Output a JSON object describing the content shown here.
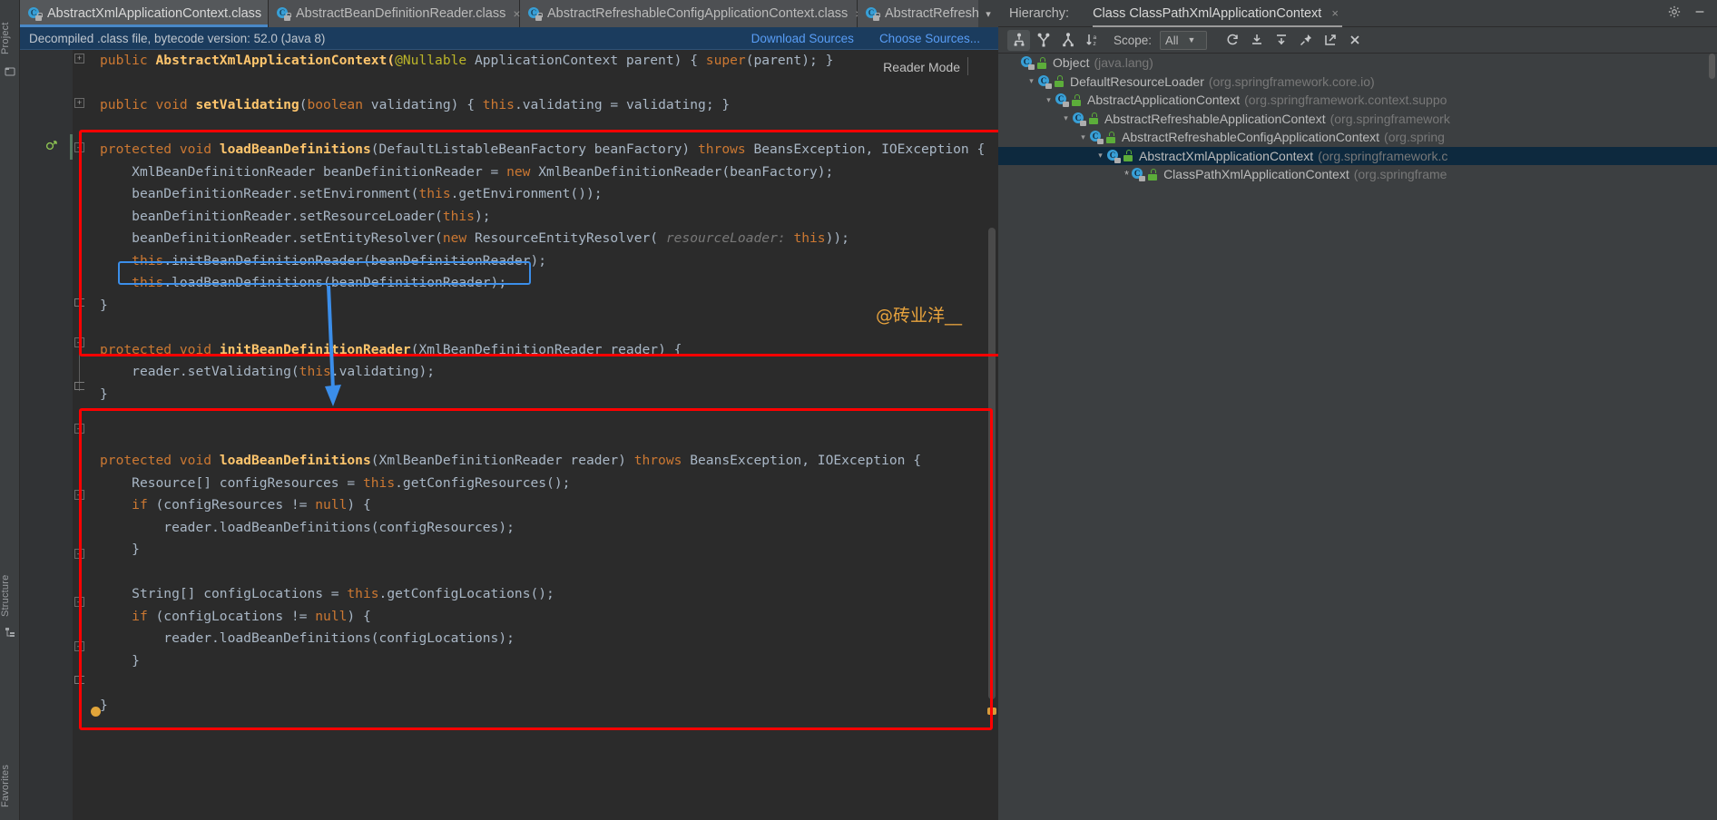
{
  "left_strip": {
    "project_label": "Project",
    "structure_label": "Structure",
    "favorites_label": "Favorites"
  },
  "tabs": [
    {
      "label": "AbstractXmlApplicationContext.class",
      "icon": "java-class-icon",
      "active": true,
      "close": "×"
    },
    {
      "label": "AbstractBeanDefinitionReader.class",
      "icon": "java-class-icon",
      "active": false,
      "close": "×"
    },
    {
      "label": "AbstractRefreshableConfigApplicationContext.class",
      "icon": "java-class-icon",
      "active": false,
      "close": "×"
    },
    {
      "label": "AbstractRefreshab",
      "icon": "java-class-icon",
      "active": false,
      "close": ""
    }
  ],
  "tab_overflow_icon": "chevron-down-icon",
  "notification": {
    "text": "Decompiled .class file, bytecode version: 52.0 (Java 8)",
    "download_sources": "Download Sources",
    "choose_sources": "Choose Sources..."
  },
  "editor": {
    "reader_mode": "Reader Mode",
    "watermark": "@砖业洋__",
    "lines": [
      {
        "indent": 0,
        "tokens": [
          {
            "t": "public ",
            "c": "kw"
          },
          {
            "t": "AbstractXmlApplicationContext(",
            "c": "mth"
          },
          {
            "t": "@Nullable",
            "c": "anno"
          },
          {
            "t": " ApplicationContext parent) { ",
            "c": "plain"
          },
          {
            "t": "super",
            "c": "kw"
          },
          {
            "t": "(parent); }",
            "c": "plain"
          }
        ]
      },
      {
        "indent": 0,
        "tokens": []
      },
      {
        "indent": 0,
        "tokens": [
          {
            "t": "public ",
            "c": "kw"
          },
          {
            "t": "void ",
            "c": "kw"
          },
          {
            "t": "setValidating",
            "c": "mth"
          },
          {
            "t": "(",
            "c": "plain"
          },
          {
            "t": "boolean",
            "c": "kw"
          },
          {
            "t": " validating) { ",
            "c": "plain"
          },
          {
            "t": "this",
            "c": "kw"
          },
          {
            "t": ".validating = validating; }",
            "c": "plain"
          }
        ]
      },
      {
        "indent": 0,
        "tokens": []
      },
      {
        "indent": 0,
        "tokens": [
          {
            "t": "protected ",
            "c": "kw"
          },
          {
            "t": "void ",
            "c": "kw"
          },
          {
            "t": "loadBeanDefinitions",
            "c": "mth"
          },
          {
            "t": "(DefaultListableBeanFactory beanFactory) ",
            "c": "plain"
          },
          {
            "t": "throws",
            "c": "kw"
          },
          {
            "t": " BeansException, IOException {",
            "c": "plain"
          }
        ]
      },
      {
        "indent": 1,
        "tokens": [
          {
            "t": "XmlBeanDefinitionReader beanDefinitionReader = ",
            "c": "plain"
          },
          {
            "t": "new",
            "c": "kw"
          },
          {
            "t": " XmlBeanDefinitionReader(beanFactory);",
            "c": "plain"
          }
        ]
      },
      {
        "indent": 1,
        "tokens": [
          {
            "t": "beanDefinitionReader.setEnvironment(",
            "c": "plain"
          },
          {
            "t": "this",
            "c": "kw"
          },
          {
            "t": ".getEnvironment());",
            "c": "plain"
          }
        ]
      },
      {
        "indent": 1,
        "tokens": [
          {
            "t": "beanDefinitionReader.setResourceLoader(",
            "c": "plain"
          },
          {
            "t": "this",
            "c": "kw"
          },
          {
            "t": ");",
            "c": "plain"
          }
        ]
      },
      {
        "indent": 1,
        "tokens": [
          {
            "t": "beanDefinitionReader.setEntityResolver(",
            "c": "plain"
          },
          {
            "t": "new",
            "c": "kw"
          },
          {
            "t": " ResourceEntityResolver( ",
            "c": "plain"
          },
          {
            "t": "resourceLoader:",
            "c": "hint"
          },
          {
            "t": " ",
            "c": "plain"
          },
          {
            "t": "this",
            "c": "kw"
          },
          {
            "t": "));",
            "c": "plain"
          }
        ]
      },
      {
        "indent": 1,
        "tokens": [
          {
            "t": "this",
            "c": "kw"
          },
          {
            "t": ".initBeanDefinitionReader(beanDefinitionReader);",
            "c": "plain"
          }
        ]
      },
      {
        "indent": 1,
        "tokens": [
          {
            "t": "this",
            "c": "kw"
          },
          {
            "t": ".loadBeanDefinitions(beanDefinitionReader);",
            "c": "plain"
          }
        ]
      },
      {
        "indent": 0,
        "tokens": [
          {
            "t": "}",
            "c": "plain"
          }
        ]
      },
      {
        "indent": 0,
        "tokens": []
      },
      {
        "indent": 0,
        "tokens": [
          {
            "t": "protected ",
            "c": "kw"
          },
          {
            "t": "void ",
            "c": "kw"
          },
          {
            "t": "initBeanDefinitionReader",
            "c": "mth"
          },
          {
            "t": "(XmlBeanDefinitionReader reader) {",
            "c": "plain"
          }
        ]
      },
      {
        "indent": 1,
        "tokens": [
          {
            "t": "reader.setValidating(",
            "c": "plain"
          },
          {
            "t": "this",
            "c": "kw"
          },
          {
            "t": ".validating);",
            "c": "plain"
          }
        ]
      },
      {
        "indent": 0,
        "tokens": [
          {
            "t": "}",
            "c": "plain"
          }
        ]
      },
      {
        "indent": 0,
        "tokens": []
      },
      {
        "indent": 0,
        "tokens": []
      },
      {
        "indent": 0,
        "tokens": [
          {
            "t": "protected ",
            "c": "kw"
          },
          {
            "t": "void ",
            "c": "kw"
          },
          {
            "t": "loadBeanDefinitions",
            "c": "mth"
          },
          {
            "t": "(XmlBeanDefinitionReader reader) ",
            "c": "plain"
          },
          {
            "t": "throws",
            "c": "kw"
          },
          {
            "t": " BeansException, IOException {",
            "c": "plain"
          }
        ]
      },
      {
        "indent": 1,
        "tokens": [
          {
            "t": "Resource[] configResources = ",
            "c": "plain"
          },
          {
            "t": "this",
            "c": "kw"
          },
          {
            "t": ".getConfigResources();",
            "c": "plain"
          }
        ]
      },
      {
        "indent": 1,
        "tokens": [
          {
            "t": "if",
            "c": "kw"
          },
          {
            "t": " (configResources != ",
            "c": "plain"
          },
          {
            "t": "null",
            "c": "kw"
          },
          {
            "t": ") {",
            "c": "plain"
          }
        ]
      },
      {
        "indent": 2,
        "tokens": [
          {
            "t": "reader.loadBeanDefinitions(configResources);",
            "c": "plain"
          }
        ]
      },
      {
        "indent": 1,
        "tokens": [
          {
            "t": "}",
            "c": "plain"
          }
        ]
      },
      {
        "indent": 0,
        "tokens": []
      },
      {
        "indent": 1,
        "tokens": [
          {
            "t": "String[] configLocations = ",
            "c": "plain"
          },
          {
            "t": "this",
            "c": "kw"
          },
          {
            "t": ".getConfigLocations();",
            "c": "plain"
          }
        ]
      },
      {
        "indent": 1,
        "tokens": [
          {
            "t": "if",
            "c": "kw"
          },
          {
            "t": " (configLocations != ",
            "c": "plain"
          },
          {
            "t": "null",
            "c": "kw"
          },
          {
            "t": ") {",
            "c": "plain"
          }
        ]
      },
      {
        "indent": 2,
        "tokens": [
          {
            "t": "reader.loadBeanDefinitions(configLocations);",
            "c": "plain"
          }
        ]
      },
      {
        "indent": 1,
        "tokens": [
          {
            "t": "}",
            "c": "plain"
          }
        ]
      },
      {
        "indent": 0,
        "tokens": []
      },
      {
        "indent": 0,
        "tokens": [
          {
            "t": "}",
            "c": "plain"
          }
        ]
      }
    ]
  },
  "hierarchy": {
    "label": "Hierarchy:",
    "tab_title": "Class ClassPathXmlApplicationContext",
    "tab_close": "×",
    "scope_label": "Scope:",
    "scope_value": "All",
    "toolbar_icons": [
      "class-hierarchy-icon",
      "supertypes-hierarchy-icon",
      "subtypes-hierarchy-icon",
      "sort-alphabetically-icon"
    ],
    "right_icons": [
      "refresh-icon",
      "expand-all-icon",
      "collapse-all-icon",
      "pin-icon",
      "open-in-new-window-icon",
      "close-icon"
    ],
    "window_icons": [
      "settings-gear-icon",
      "minimize-icon"
    ],
    "tree": [
      {
        "depth": 0,
        "twisty": "",
        "star": false,
        "name": "Object",
        "pkg": "(java.lang)",
        "selected": false
      },
      {
        "depth": 1,
        "twisty": "v",
        "star": false,
        "name": "DefaultResourceLoader",
        "pkg": "(org.springframework.core.io)",
        "selected": false
      },
      {
        "depth": 2,
        "twisty": "v",
        "star": false,
        "name": "AbstractApplicationContext",
        "pkg": "(org.springframework.context.suppo",
        "selected": false
      },
      {
        "depth": 3,
        "twisty": "v",
        "star": false,
        "name": "AbstractRefreshableApplicationContext",
        "pkg": "(org.springframework",
        "selected": false
      },
      {
        "depth": 4,
        "twisty": "v",
        "star": false,
        "name": "AbstractRefreshableConfigApplicationContext",
        "pkg": "(org.spring",
        "selected": false
      },
      {
        "depth": 5,
        "twisty": "v",
        "star": false,
        "name": "AbstractXmlApplicationContext",
        "pkg": "(org.springframework.c",
        "selected": true,
        "highlighted": true
      },
      {
        "depth": 6,
        "twisty": "",
        "star": true,
        "name": "ClassPathXmlApplicationContext",
        "pkg": "(org.springframe",
        "selected": false
      }
    ]
  },
  "colors": {
    "accent_blue": "#4a88c7",
    "annotation_red": "#ff0000",
    "selection_blue": "#3b8eea",
    "watermark_orange": "#e8a33d",
    "editor_bg": "#2b2b2b",
    "panel_bg": "#3c3f41"
  }
}
